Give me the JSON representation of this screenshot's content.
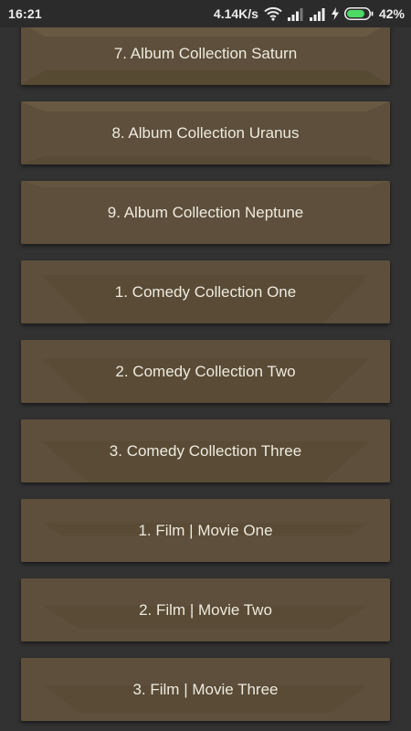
{
  "status_bar": {
    "time": "16:21",
    "net_speed": "4.14K/s",
    "battery_percent": "42%",
    "icons": [
      "wifi-icon",
      "signal-icon",
      "signal-icon",
      "charging-icon",
      "battery-icon"
    ]
  },
  "list": {
    "items": [
      {
        "label": "7. Album Collection Saturn"
      },
      {
        "label": "8. Album Collection Uranus"
      },
      {
        "label": "9. Album Collection Neptune"
      },
      {
        "label": "1. Comedy Collection One"
      },
      {
        "label": "2. Comedy Collection Two"
      },
      {
        "label": "3. Comedy Collection Three"
      },
      {
        "label": "1. Film | Movie One"
      },
      {
        "label": "2. Film | Movie Two"
      },
      {
        "label": "3. Film | Movie Three"
      }
    ]
  },
  "colors": {
    "background": "#323232",
    "button": "#5d4f3b",
    "button_text": "#eeeadf",
    "status_bar": "#2b2b2b",
    "battery_fill": "#4cd964"
  }
}
